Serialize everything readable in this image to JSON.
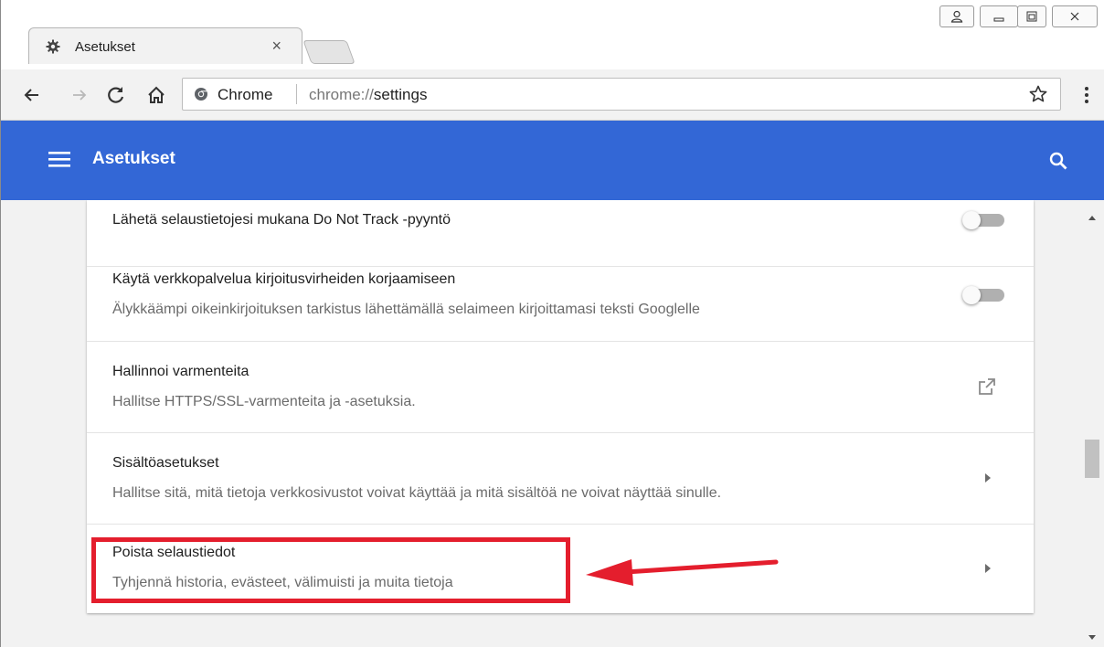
{
  "browser": {
    "tab": {
      "title": "Asetukset",
      "close_glyph": "×",
      "icon": "gear-icon"
    },
    "window_controls": [
      "user-icon",
      "minimize-icon",
      "maximize-icon",
      "close-icon"
    ],
    "toolbar": {
      "omnibox": {
        "chip_label": "Chrome",
        "url_prefix": "chrome://",
        "url_path": "settings"
      }
    }
  },
  "app_header": {
    "title": "Asetukset",
    "menu_icon": "hamburger-icon",
    "search_icon": "search-icon",
    "color": "#3367d6"
  },
  "settings": {
    "rows": [
      {
        "title": "Lähetä selaustietojesi mukana Do Not Track -pyyntö",
        "control": "toggle",
        "toggle_on": false
      },
      {
        "title": "Käytä verkkopalvelua kirjoitusvirheiden korjaamiseen",
        "subtitle": "Älykkäämpi oikeinkirjoituksen tarkistus lähettämällä selaimeen kirjoittamasi teksti Googlelle",
        "control": "toggle",
        "toggle_on": false
      },
      {
        "title": "Hallinnoi varmenteita",
        "subtitle": "Hallitse HTTPS/SSL-varmenteita ja -asetuksia.",
        "control": "external-link-icon"
      },
      {
        "title": "Sisältöasetukset",
        "subtitle": "Hallitse sitä, mitä tietoja verkkosivustot voivat käyttää ja mitä sisältöä ne voivat näyttää sinulle.",
        "control": "chevron-right-icon"
      },
      {
        "title": "Poista selaustiedot",
        "subtitle": "Tyhjennä historia, evästeet, välimuisti ja muita tietoja",
        "control": "chevron-right-icon"
      }
    ]
  },
  "annotation": {
    "highlight_color": "#e41e2d",
    "target": "Poista selaustiedot"
  }
}
